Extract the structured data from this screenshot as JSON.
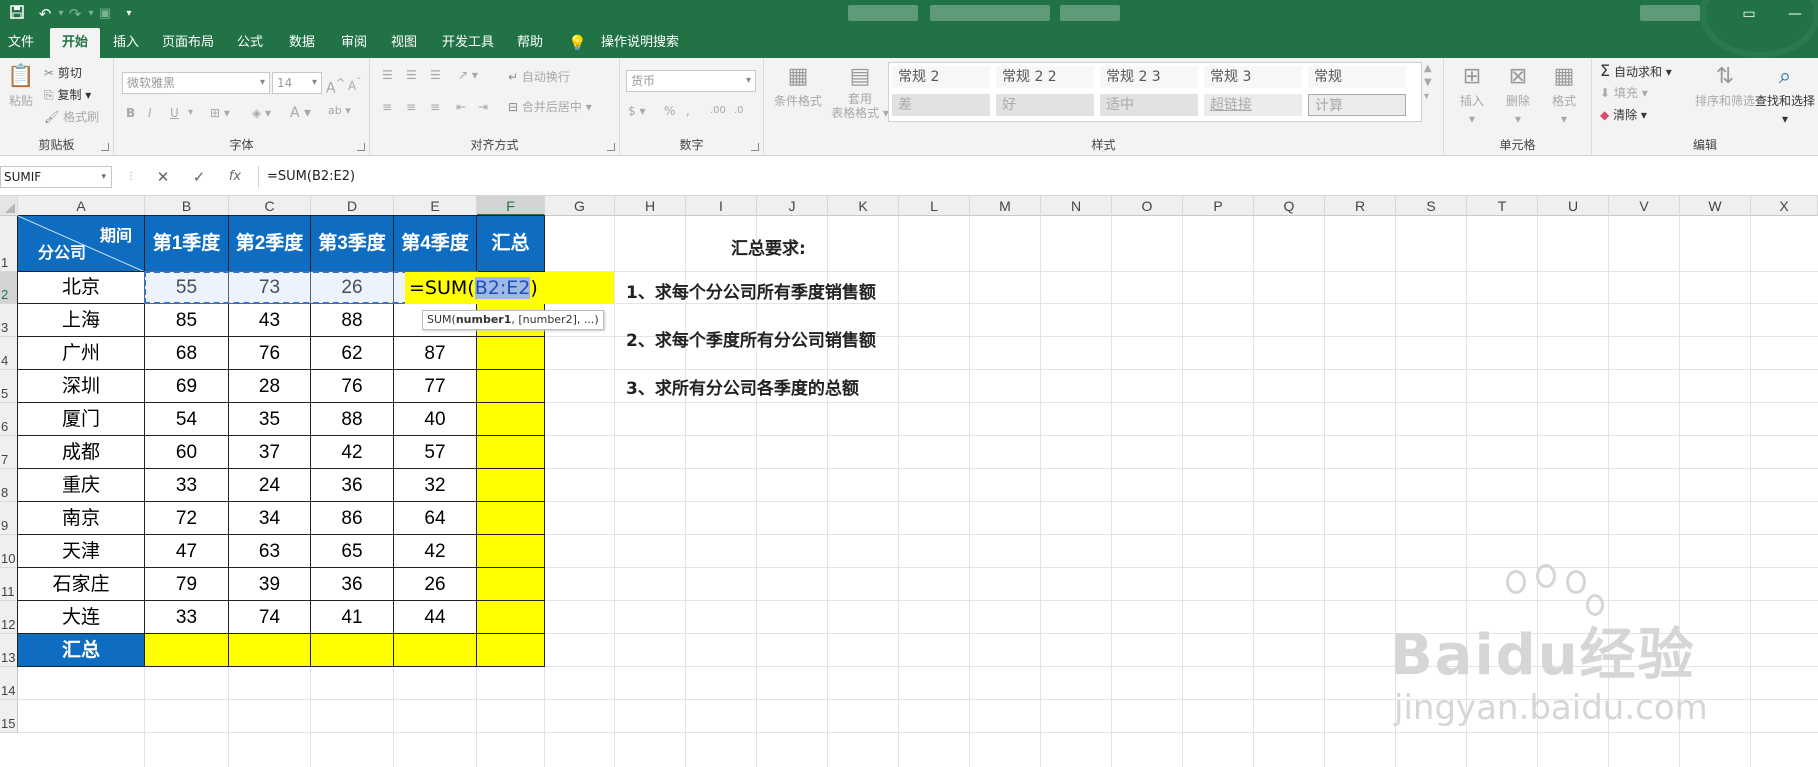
{
  "quick_access": {
    "save_icon": "save-icon",
    "undo_icon": "undo-icon",
    "redo_icon": "redo-icon",
    "camera_icon": "camera-icon",
    "customize_icon": "chevron-down-icon"
  },
  "menu": [
    "文件",
    "开始",
    "插入",
    "页面布局",
    "公式",
    "数据",
    "审阅",
    "视图",
    "开发工具",
    "帮助",
    "操作说明搜索"
  ],
  "ribbon": {
    "clipboard": {
      "paste": "粘贴",
      "cut": "剪切",
      "copy": "复制",
      "format_painter": "格式刷",
      "label": "剪贴板"
    },
    "font": {
      "name": "微软雅黑",
      "size": "14",
      "grow": "A",
      "shrink": "A",
      "bold": "B",
      "italic": "I",
      "underline": "U",
      "font_color": "A",
      "phonetic": "ab",
      "label": "字体"
    },
    "alignment": {
      "wrap": "自动换行",
      "merge": "合并后居中",
      "label": "对齐方式"
    },
    "number": {
      "format": "货币",
      "percent": "%",
      "comma": ",",
      "label": "数字"
    },
    "styles": {
      "conditional": "条件格式",
      "table_format_1": "套用",
      "table_format_2": "表格格式",
      "cells": [
        "常规 2",
        "常规 2 2",
        "常规 2 3",
        "常规 3",
        "常规",
        "差",
        "好",
        "适中",
        "超链接",
        "计算"
      ],
      "label": "样式"
    },
    "cells": {
      "insert": "插入",
      "delete": "删除",
      "format": "格式",
      "label": "单元格"
    },
    "editing": {
      "autosum": "自动求和",
      "fill": "填充",
      "clear": "清除",
      "sort": "排序和筛选",
      "find": "查找和选择",
      "label": "编辑"
    }
  },
  "formula_bar": {
    "name_box": "SUMIF",
    "cancel": "✕",
    "enter": "✓",
    "fx": "fx",
    "formula": "=SUM(B2:E2)"
  },
  "columns": [
    "A",
    "B",
    "C",
    "D",
    "E",
    "F",
    "G",
    "H",
    "I",
    "J",
    "K",
    "L",
    "M",
    "N",
    "O",
    "P",
    "Q",
    "R",
    "S",
    "T",
    "U",
    "V",
    "W",
    "X"
  ],
  "rows": [
    "1",
    "2",
    "3",
    "4",
    "5",
    "6",
    "7",
    "8",
    "9",
    "10",
    "11",
    "12",
    "13",
    "14",
    "15"
  ],
  "table": {
    "corner_top": "期间",
    "corner_bottom": "分公司",
    "headers": [
      "第1季度",
      "第2季度",
      "第3季度",
      "第4季度",
      "汇总"
    ],
    "rows": [
      {
        "name": "北京",
        "values": [
          "55",
          "73",
          "26",
          ""
        ]
      },
      {
        "name": "上海",
        "values": [
          "85",
          "43",
          "88",
          ""
        ]
      },
      {
        "name": "广州",
        "values": [
          "68",
          "76",
          "62",
          "87"
        ]
      },
      {
        "name": "深圳",
        "values": [
          "69",
          "28",
          "76",
          "77"
        ]
      },
      {
        "name": "厦门",
        "values": [
          "54",
          "35",
          "88",
          "40"
        ]
      },
      {
        "name": "成都",
        "values": [
          "60",
          "37",
          "42",
          "57"
        ]
      },
      {
        "name": "重庆",
        "values": [
          "33",
          "24",
          "36",
          "32"
        ]
      },
      {
        "name": "南京",
        "values": [
          "72",
          "34",
          "86",
          "64"
        ]
      },
      {
        "name": "天津",
        "values": [
          "47",
          "63",
          "65",
          "42"
        ]
      },
      {
        "name": "石家庄",
        "values": [
          "79",
          "39",
          "36",
          "26"
        ]
      },
      {
        "name": "大连",
        "values": [
          "33",
          "74",
          "41",
          "44"
        ]
      }
    ],
    "total_label": "汇总"
  },
  "editing_cell": {
    "prefix": "=SUM(",
    "ref": "B2:E2",
    "suffix": ")"
  },
  "tooltip": {
    "fn": "SUM(",
    "arg1": "number1",
    "rest": ", [number2], ...)"
  },
  "notes": {
    "title": "汇总要求:",
    "items": [
      "1、求每个分公司所有季度销售额",
      "2、求每个季度所有分公司销售额",
      "3、求所有分公司各季度的总额"
    ]
  },
  "watermark": {
    "logo": "Baidu经验",
    "url": "jingyan.baidu.com"
  },
  "colors": {
    "excel_green": "#217346",
    "header_blue": "#0f6dc1",
    "highlight_yellow": "#ffff00"
  }
}
